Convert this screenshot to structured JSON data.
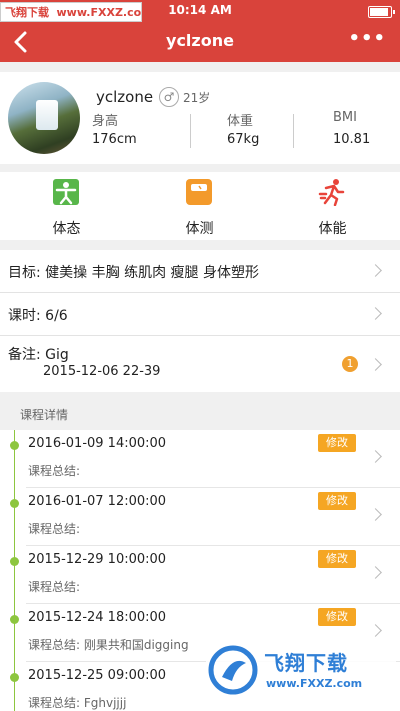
{
  "status_bar": {
    "time": "10:14 AM",
    "watermark_site": "飞翔下载",
    "watermark_url": "www.FXXZ.com"
  },
  "nav": {
    "title": "yclzone",
    "more": "•••"
  },
  "profile": {
    "username": "yclzone",
    "gender_symbol": "♂",
    "age": "21岁",
    "height_label": "身高",
    "height_value": "176cm",
    "weight_label": "体重",
    "weight_value": "67kg",
    "bmi_label": "BMI",
    "bmi_value": "10.81"
  },
  "tabs": [
    {
      "label": "体态",
      "icon": "posture-icon",
      "color": "#58b64a"
    },
    {
      "label": "体测",
      "icon": "scale-icon",
      "color": "#f39a2b"
    },
    {
      "label": "体能",
      "icon": "running-icon",
      "color": "#e8443a"
    }
  ],
  "rows": {
    "goal": "目标: 健美操 丰胸 练肌肉 瘦腿 身体塑形",
    "lessons": "课时: 6/6",
    "note_label": "备注: Gig",
    "note_date": "2015-12-06 22-39",
    "note_badge": "1"
  },
  "section": {
    "title": "课程详情"
  },
  "entries": [
    {
      "date": "2016-01-09 14:00:00",
      "summary": "课程总结:",
      "edit": "修改"
    },
    {
      "date": "2016-01-07 12:00:00",
      "summary": "课程总结:",
      "edit": "修改"
    },
    {
      "date": "2015-12-29 10:00:00",
      "summary": "课程总结:",
      "edit": "修改"
    },
    {
      "date": "2015-12-24 18:00:00",
      "summary": "课程总结:  刚果共和国digging",
      "edit": "修改"
    },
    {
      "date": "2015-12-25 09:00:00",
      "summary": "课程总结:  Fghvjjjj",
      "edit": ""
    }
  ],
  "watermark_bottom": {
    "brand": "飞翔下载",
    "url": "www.FXXZ.com"
  },
  "colors": {
    "brand_red": "#d9433b",
    "timeline_green": "#8dc63f",
    "edit_orange": "#f5a623"
  }
}
